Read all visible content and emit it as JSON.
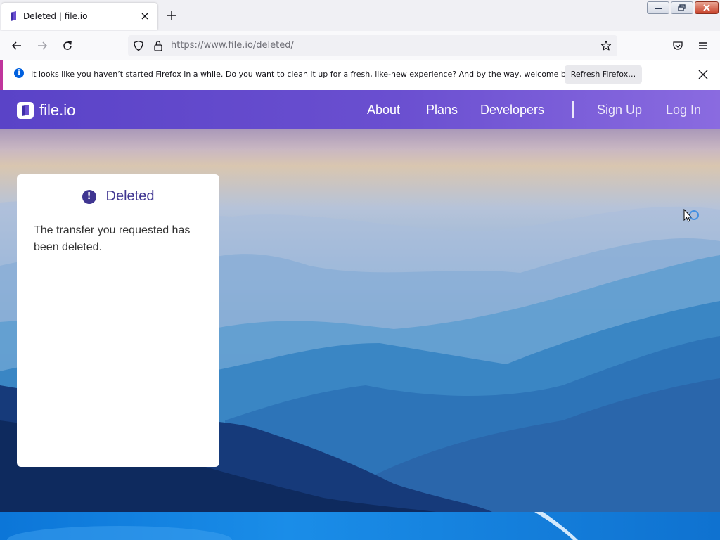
{
  "browser": {
    "tab_title": "Deleted | file.io",
    "url": "https://www.file.io/deleted/",
    "notification": {
      "text": "It looks like you haven’t started Firefox in a while. Do you want to clean it up for a fresh, like-new experience? And by the way, welcome back!",
      "button": "Refresh Firefox…"
    },
    "icons": [
      "close-icon",
      "plus-icon",
      "back-icon",
      "forward-icon",
      "reload-icon",
      "shield-icon",
      "lock-icon",
      "star-icon",
      "pocket-icon",
      "menu-icon",
      "info-icon"
    ]
  },
  "site": {
    "logo_text": "file.io",
    "nav": {
      "about": "About",
      "plans": "Plans",
      "developers": "Developers",
      "signup": "Sign Up",
      "login": "Log In"
    },
    "card": {
      "title": "Deleted",
      "message": "The transfer you requested has been deleted."
    }
  },
  "colors": {
    "header_start": "#5a43c7",
    "header_end": "#8a6be0",
    "card_title": "#3f3591",
    "notification_accent": "#c0359c"
  }
}
